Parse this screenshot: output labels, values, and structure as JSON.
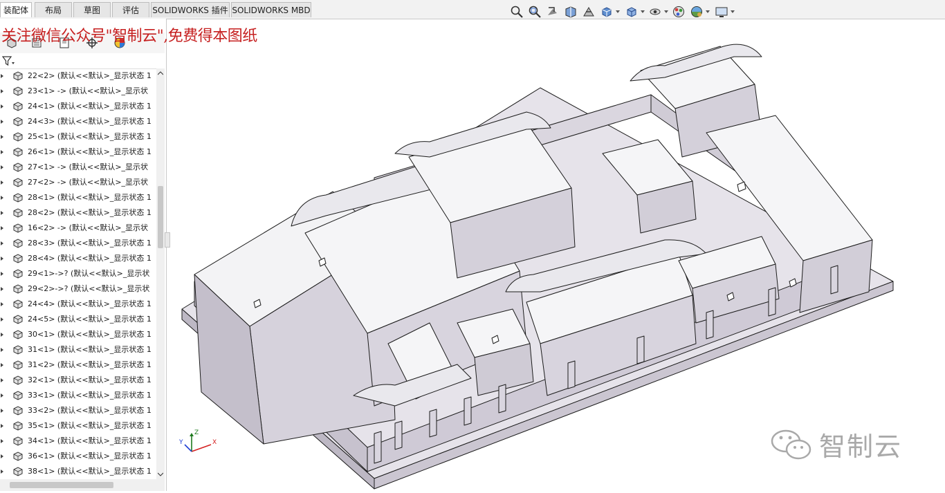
{
  "tabs": [
    {
      "label": "装配体",
      "active": true
    },
    {
      "label": "布局",
      "active": false
    },
    {
      "label": "草图",
      "active": false
    },
    {
      "label": "评估",
      "active": false
    },
    {
      "label": "SOLIDWORKS 插件",
      "active": false
    },
    {
      "label": "SOLIDWORKS MBD",
      "active": false
    }
  ],
  "hud_icons": [
    "zoom-to-fit-icon",
    "zoom-to-area-icon",
    "previous-view-icon",
    "section-view-icon",
    "dynamic-annotation-icon",
    "view-orientation-icon",
    "display-style-icon",
    "hide-show-items-icon",
    "edit-appearance-icon",
    "apply-scene-icon",
    "view-settings-icon"
  ],
  "promo_text": "关注微信公众号\"智制云\",免费得本图纸",
  "panel_tabs": [
    "featuremanager-tree-icon",
    "propertymanager-icon",
    "configurationmanager-icon",
    "dimxpertmanager-icon",
    "display-manager-icon"
  ],
  "tree_items": [
    "22<2> (默认<<默认>_显示状态 1",
    "23<1> -> (默认<<默认>_显示状",
    "24<1> (默认<<默认>_显示状态 1",
    "24<3> (默认<<默认>_显示状态 1",
    "25<1> (默认<<默认>_显示状态 1",
    "26<1> (默认<<默认>_显示状态 1",
    "27<1> -> (默认<<默认>_显示状",
    "27<2> -> (默认<<默认>_显示状",
    "28<1> (默认<<默认>_显示状态 1",
    "28<2> (默认<<默认>_显示状态 1",
    "16<2> -> (默认<<默认>_显示状",
    "28<3> (默认<<默认>_显示状态 1",
    "28<4> (默认<<默认>_显示状态 1",
    "29<1>->? (默认<<默认>_显示状",
    "29<2>->? (默认<<默认>_显示状",
    "24<4> (默认<<默认>_显示状态 1",
    "24<5> (默认<<默认>_显示状态 1",
    "30<1> (默认<<默认>_显示状态 1",
    "31<1> (默认<<默认>_显示状态 1",
    "31<2> (默认<<默认>_显示状态 1",
    "32<1> (默认<<默认>_显示状态 1",
    "33<1> (默认<<默认>_显示状态 1",
    "33<2> (默认<<默认>_显示状态 1",
    "35<1> (默认<<默认>_显示状态 1",
    "34<1> (默认<<默认>_显示状态 1",
    "36<1> (默认<<默认>_显示状态 1",
    "38<1> (默认<<默认>_显示状态 1"
  ],
  "triad": {
    "x": "X",
    "y": "Y",
    "z": "Z"
  },
  "brand_text": "智制云",
  "colors": {
    "promo": "#c62020",
    "model_face": "#d7d3db",
    "model_roof": "#f4f4f6",
    "model_edge": "#1b1b1b",
    "brand": "#a9a9a9"
  }
}
